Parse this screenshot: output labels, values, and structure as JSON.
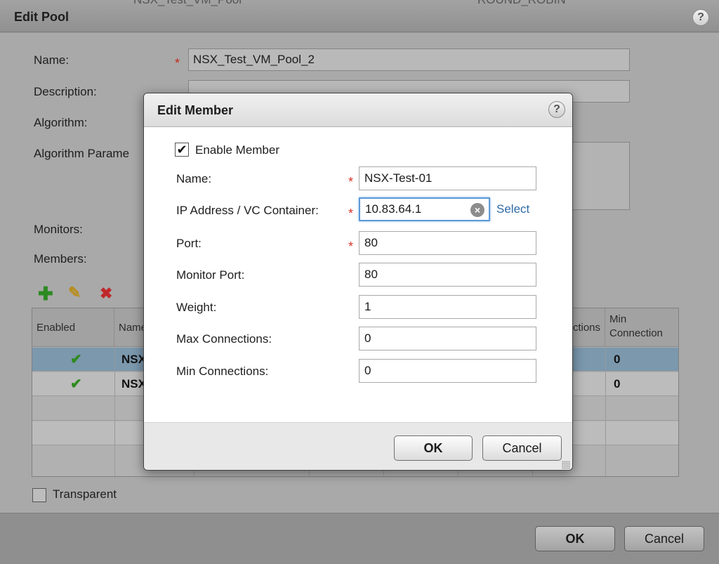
{
  "outer": {
    "behind_text_left": "NSX_Test_VM_Pool",
    "behind_text_right": "ROUND_ROBIN",
    "title": "Edit Pool",
    "help": "?",
    "fields": {
      "name_label": "Name:",
      "name_value": "NSX_Test_VM_Pool_2",
      "description_label": "Description:",
      "algorithm_label": "Algorithm:",
      "algorithm_params_label": "Algorithm Parame",
      "monitors_label": "Monitors:",
      "members_label": "Members:"
    },
    "required_mark": "*",
    "toolbar": {
      "add_icon": "plus-icon",
      "edit_icon": "pencil-icon",
      "delete_icon": "x-icon"
    },
    "table": {
      "headers": {
        "enabled": "Enabled",
        "name": "Name",
        "max_connections_partial": "ctions",
        "min_connections": "Min Connection"
      },
      "rows": [
        {
          "enabled": "✔",
          "name": "NSX",
          "min": "0",
          "selected": true
        },
        {
          "enabled": "✔",
          "name": "NSX",
          "min": "0",
          "selected": false
        }
      ]
    },
    "transparent_label": "Transparent",
    "ok_label": "OK",
    "cancel_label": "Cancel"
  },
  "modal": {
    "title": "Edit Member",
    "help": "?",
    "enable_member_label": "Enable Member",
    "enable_member_checked": "✔",
    "required_mark": "*",
    "fields": [
      {
        "label": "Name:",
        "value": "NSX-Test-01",
        "required": true
      },
      {
        "label": "IP Address / VC Container:",
        "value": "10.83.64.1",
        "required": true
      },
      {
        "label": "Port:",
        "value": "80",
        "required": true
      },
      {
        "label": "Monitor Port:",
        "value": "80",
        "required": false
      },
      {
        "label": "Weight:",
        "value": "1",
        "required": false
      },
      {
        "label": "Max Connections:",
        "value": "0",
        "required": false
      },
      {
        "label": "Min Connections:",
        "value": "0",
        "required": false
      }
    ],
    "select_link": "Select",
    "clear_icon": "×",
    "ok_label": "OK",
    "cancel_label": "Cancel"
  }
}
